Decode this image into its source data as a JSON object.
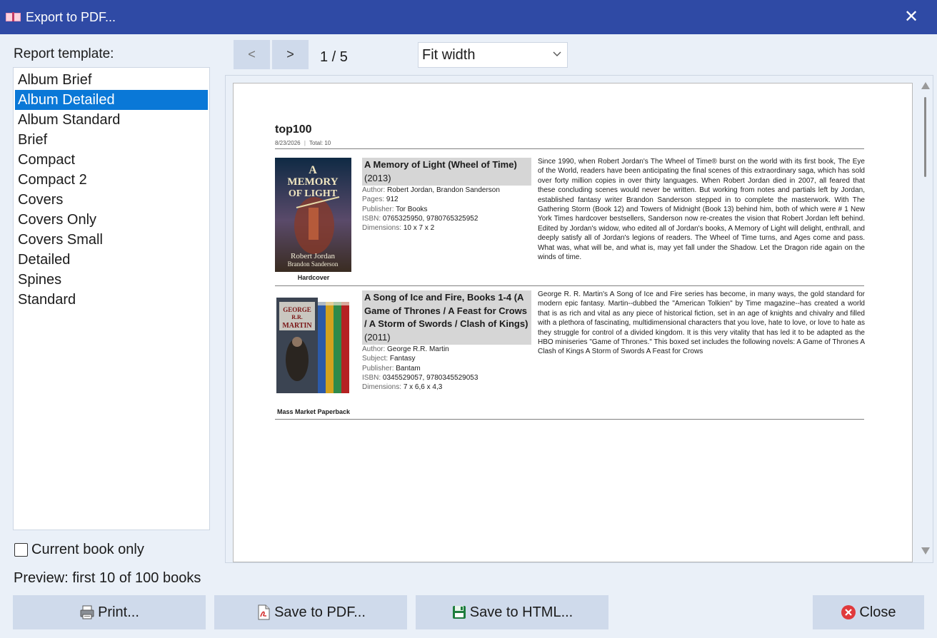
{
  "window": {
    "title": "Export to PDF..."
  },
  "template_panel": {
    "label": "Report template:",
    "items": [
      "Album Brief",
      "Album Detailed",
      "Album Standard",
      "Brief",
      "Compact",
      "Compact 2",
      "Covers",
      "Covers Only",
      "Covers Small",
      "Detailed",
      "Spines",
      "Standard"
    ],
    "selected": "Album Detailed"
  },
  "options": {
    "current_book_only_label": "Current book only",
    "current_book_only_checked": false
  },
  "preview_note": "Preview: first 10 of 100 books",
  "pager": {
    "prev_label": "<",
    "next_label": ">",
    "counter": "1 / 5"
  },
  "zoom": {
    "selected": "Fit width"
  },
  "report": {
    "title": "top100",
    "date": "8/23/2026",
    "separator": "|",
    "total": "Total: 10",
    "books": [
      {
        "title": "A Memory of Light (Wheel of Time)",
        "year": "(2013)",
        "format": "Hardcover",
        "fields": [
          {
            "label": "Author:",
            "value": "Robert Jordan, Brandon Sanderson"
          },
          {
            "label": "Pages:",
            "value": "912"
          },
          {
            "label": "Publisher:",
            "value": "Tor Books"
          },
          {
            "label": "ISBN:",
            "value": "0765325950, 9780765325952"
          },
          {
            "label": "Dimensions:",
            "value": "10 x 7 x 2"
          }
        ],
        "cover_text": {
          "line1": "A",
          "line2": "MEMORY",
          "line3": "OF LIGHT",
          "author1": "Robert Jordan",
          "author2": "Brandon Sanderson"
        },
        "description": "Since 1990, when Robert Jordan's The Wheel of Time® burst on the world with its first book, The Eye of the World, readers have been anticipating the final scenes of this extraordinary saga, which has sold over forty million copies in over thirty languages. When Robert Jordan died in 2007, all feared that these concluding scenes would never be written. But working from notes and partials left by Jordan, established fantasy writer Brandon Sanderson stepped in to complete the masterwork. With The Gathering Storm (Book 12) and Towers of Midnight (Book 13) behind him, both of which were # 1 New York Times hardcover bestsellers, Sanderson now re-creates the vision that Robert Jordan left behind. Edited by Jordan's widow, who edited all of Jordan's books, A Memory of Light will delight, enthrall, and deeply satisfy all of Jordan's legions of readers. The Wheel of Time turns, and Ages come and pass. What was, what will be, and what is, may yet fall under the Shadow. Let the Dragon ride again on the winds of time."
      },
      {
        "title": "A Song of Ice and Fire, Books 1-4 (A Game of Thrones / A Feast for Crows / A Storm of Swords / Clash of Kings)",
        "year": "(2011)",
        "format": "Mass Market Paperback",
        "fields": [
          {
            "label": "Author:",
            "value": "George R.R. Martin"
          },
          {
            "label": "Subject:",
            "value": "Fantasy"
          },
          {
            "label": "Publisher:",
            "value": "Bantam"
          },
          {
            "label": "ISBN:",
            "value": "0345529057, 9780345529053"
          },
          {
            "label": "Dimensions:",
            "value": "7 x 6,6 x 4,3"
          }
        ],
        "cover_text": {
          "line1": "GEORGE",
          "line2": "R.R.",
          "line3": "MARTIN"
        },
        "description": "George R. R. Martin's A Song of Ice and Fire series has become, in many ways, the gold standard for modern epic fantasy. Martin--dubbed the \"American Tolkien\" by Time magazine--has created a world that is as rich and vital as any piece of historical fiction, set in an age of knights and chivalry and filled with a plethora of fascinating, multidimensional characters that you love, hate to love, or love to hate as they struggle for control of a divided kingdom. It is this very vitality that has led it to be adapted as the HBO miniseries \"Game of Thrones.\" This boxed set includes the following novels: A Game of Thrones A Clash of Kings A Storm of Swords A Feast for Crows"
      }
    ]
  },
  "buttons": {
    "print": "Print...",
    "save_pdf": "Save to PDF...",
    "save_html": "Save to HTML...",
    "close": "Close"
  },
  "colors": {
    "titlebar": "#2f4aa5",
    "selection": "#0a78d7",
    "button": "#cfdaeb",
    "background": "#eaf0f8"
  }
}
